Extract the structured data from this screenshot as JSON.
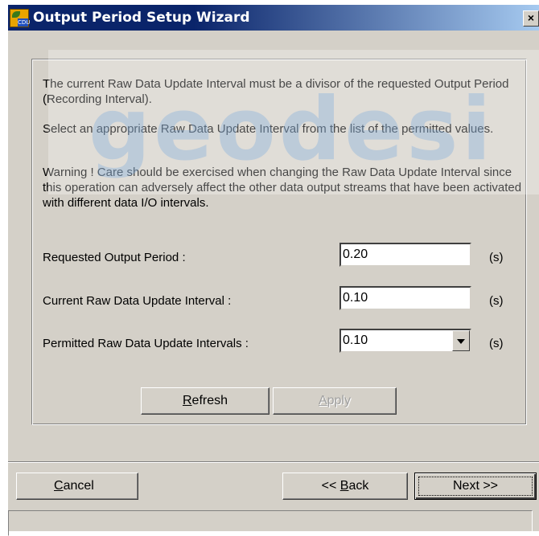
{
  "window": {
    "title": "Output Period Setup Wizard",
    "app_icon_label": "CDU",
    "close_glyph": "×"
  },
  "info": {
    "p1": "The current Raw Data Update Interval must be a divisor of the requested Output Period (Recording Interval).",
    "p2": "Select an appropriate Raw Data Update Interval from the list of the permitted values.",
    "p3": "Warning ! Care should be exercised when changing the Raw Data Update Interval since this operation can adversely affect the other data output streams that have been activated with different data I/O intervals."
  },
  "watermark": {
    "text": "geodesi"
  },
  "fields": {
    "requested_output_period": {
      "label": "Requested Output Period :",
      "value": "0.20",
      "unit": "(s)"
    },
    "current_raw_interval": {
      "label": "Current Raw Data Update Interval :",
      "value": "0.10",
      "unit": "(s)"
    },
    "permitted_raw_intervals": {
      "label": "Permitted Raw Data Update Intervals :",
      "value": "0.10",
      "unit": "(s)"
    }
  },
  "buttons": {
    "refresh": {
      "mnemonic": "R",
      "rest": "efresh"
    },
    "apply": {
      "mnemonic": "A",
      "rest": "pply"
    },
    "cancel": {
      "mnemonic": "C",
      "rest": "ancel"
    },
    "back": {
      "prefix": "<< ",
      "mnemonic": "B",
      "rest": "ack"
    },
    "next": {
      "label": "Next >>"
    }
  },
  "colors": {
    "titlebar": "#0a246a",
    "face": "#d4d0c8",
    "icon": "#e8a400"
  }
}
